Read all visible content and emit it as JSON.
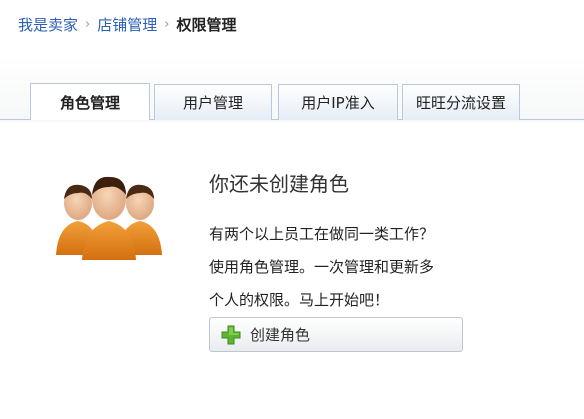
{
  "breadcrumb": {
    "items": [
      "我是卖家",
      "店铺管理"
    ],
    "current": "权限管理",
    "separator": "›"
  },
  "tabs": [
    {
      "label": "角色管理",
      "active": true
    },
    {
      "label": "用户管理",
      "active": false
    },
    {
      "label": "用户IP准入",
      "active": false
    },
    {
      "label": "旺旺分流设置",
      "active": false
    }
  ],
  "empty_state": {
    "heading": "你还未创建角色",
    "desc_lines": [
      "有两个以上员工在做同一类工作？",
      "使用角色管理。一次管理和更新多",
      "个人的权限。马上开始吧！"
    ],
    "button_label": "创建角色",
    "icons": {
      "avatar": "user-group-icon",
      "button": "plus-icon"
    }
  },
  "colors": {
    "link": "#2b5fb6",
    "tab_border": "#b9c8de",
    "plus_green": "#5cb531"
  }
}
